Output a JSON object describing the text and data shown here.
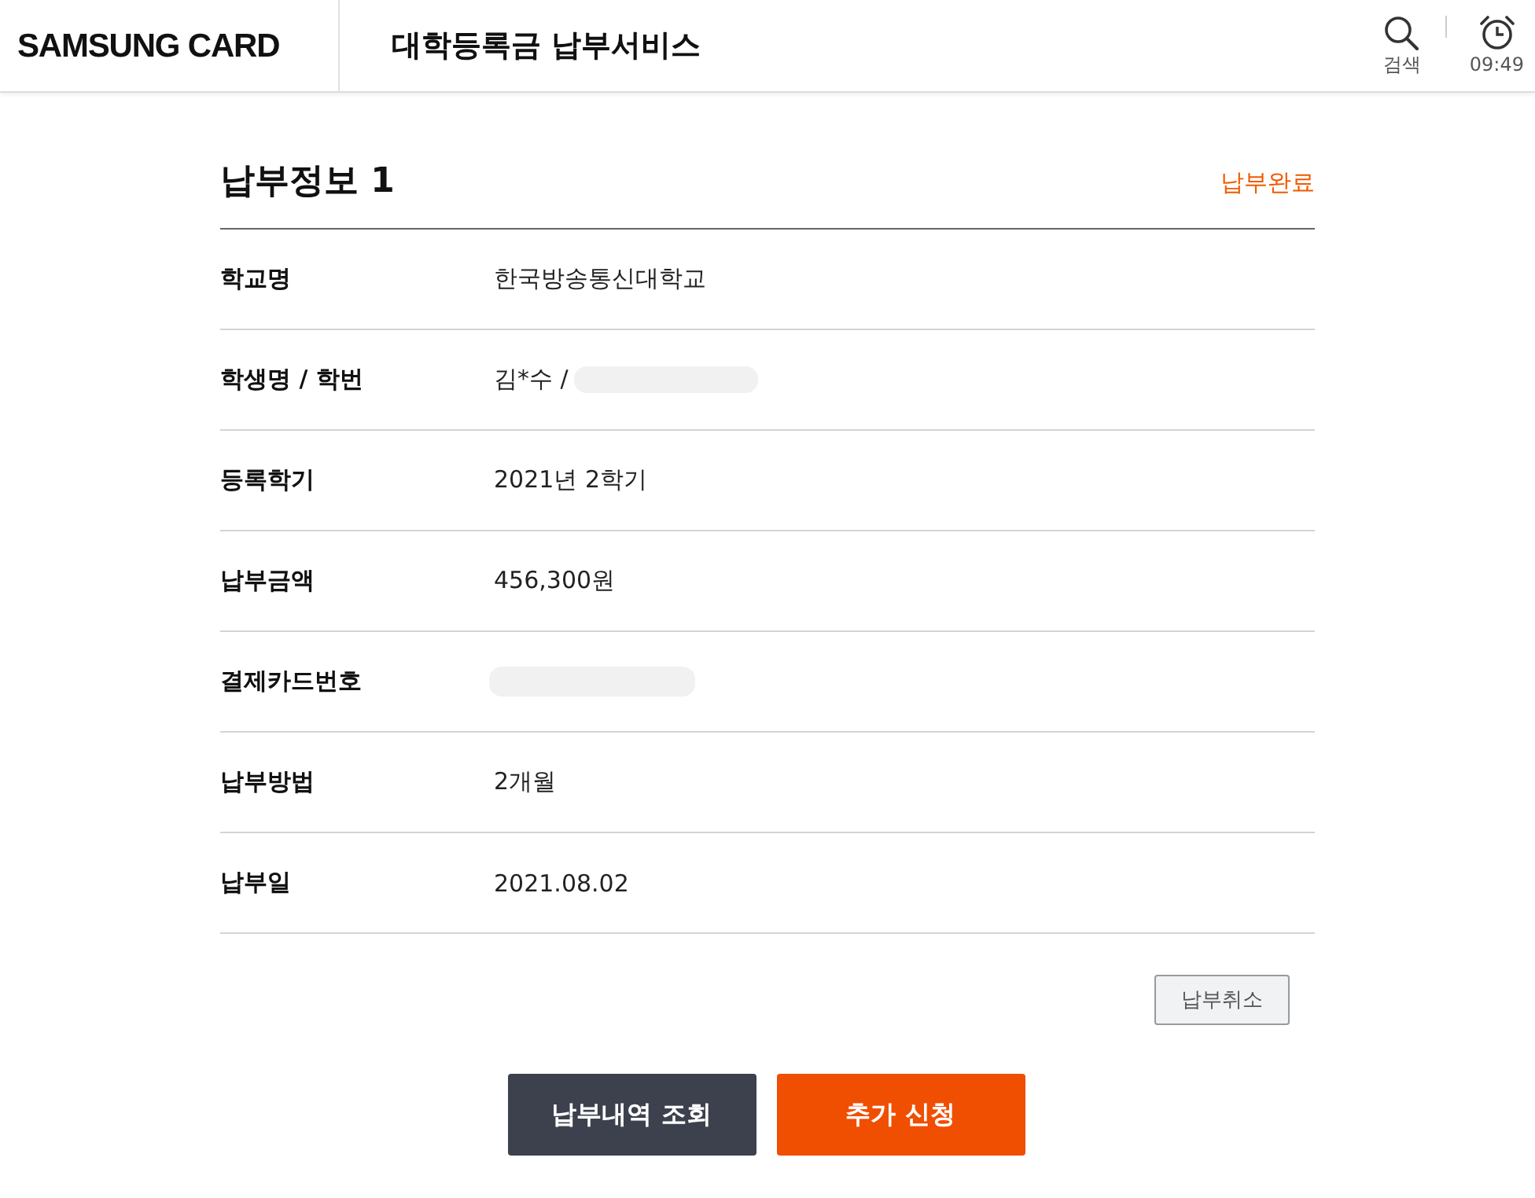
{
  "header": {
    "logo": "SAMSUNG CARD",
    "title": "대학등록금 납부서비스",
    "actions": [
      {
        "kind": "search",
        "label": "검색"
      },
      {
        "kind": "timer",
        "label": "09:49"
      }
    ]
  },
  "section": {
    "title": "납부정보 1",
    "status": "납부완료"
  },
  "rows": [
    {
      "label": "학교명",
      "value": "한국방송통신대학교"
    },
    {
      "label": "학생명 / 학번",
      "value": "김*수 /",
      "redacted": true
    },
    {
      "label": "등록학기",
      "value": "2021년 2학기"
    },
    {
      "label": "납부금액",
      "value": "456,300원"
    },
    {
      "label": "결제카드번호",
      "redacted": true
    },
    {
      "label": "납부방법",
      "value": "2개월"
    },
    {
      "label": "납부일",
      "value": "2021.08.02"
    }
  ],
  "cancel_button": "납부취소",
  "buttons": [
    {
      "label": "납부내역 조회",
      "kind": "secondary"
    },
    {
      "label": "추가 신청",
      "kind": "primary"
    }
  ]
}
